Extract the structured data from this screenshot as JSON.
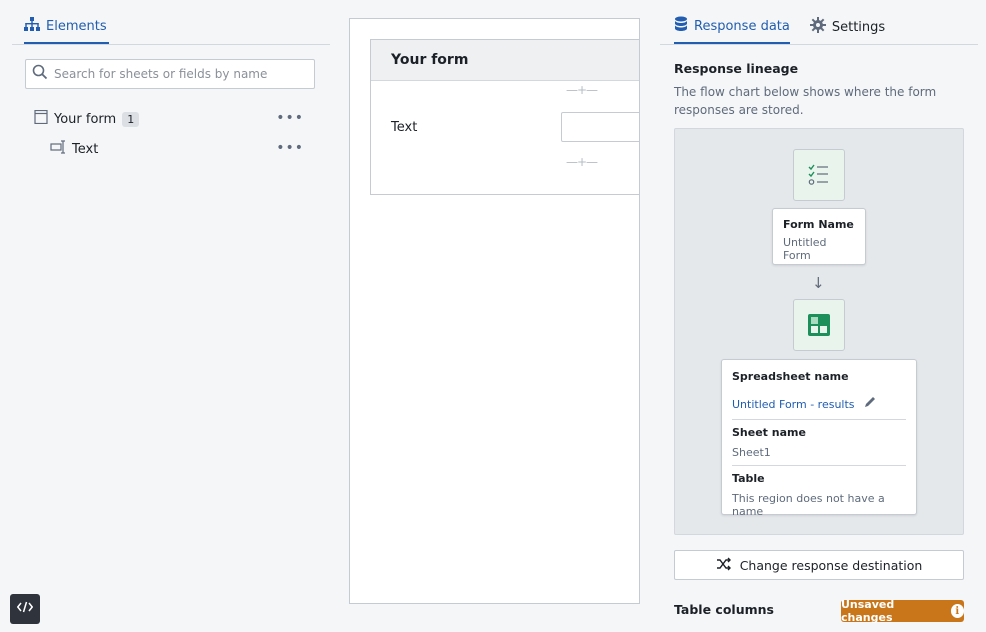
{
  "left": {
    "tab_label": "Elements",
    "search_placeholder": "Search for sheets or fields by name",
    "tree": [
      {
        "label": "Your form",
        "badge": "1"
      },
      {
        "label": "Text"
      }
    ],
    "more_icon": "more-horizontal-icon"
  },
  "canvas": {
    "form_title": "Your form",
    "field_label": "Text",
    "adder_symbol": "—+—"
  },
  "right": {
    "tabs": [
      {
        "label": "Response data",
        "icon": "database-icon",
        "active": true
      },
      {
        "label": "Settings",
        "icon": "gear-icon",
        "active": false
      }
    ],
    "lineage_title": "Response lineage",
    "lineage_desc": "The flow chart below shows where the form responses are stored.",
    "form_node": {
      "title": "Form Name",
      "value": "Untitled Form"
    },
    "sheet_node": {
      "spreadsheet_title": "Spreadsheet name",
      "spreadsheet_value": "Untitled Form - results",
      "sheet_title": "Sheet name",
      "sheet_value": "Sheet1",
      "table_title": "Table",
      "table_value": "This region does not have a name"
    },
    "change_button": "Change response destination",
    "table_columns_label": "Table columns",
    "unsaved_label": "Unsaved changes"
  },
  "colors": {
    "accent": "#215db0",
    "warning": "#c87619",
    "green": "#1c8f5a"
  }
}
